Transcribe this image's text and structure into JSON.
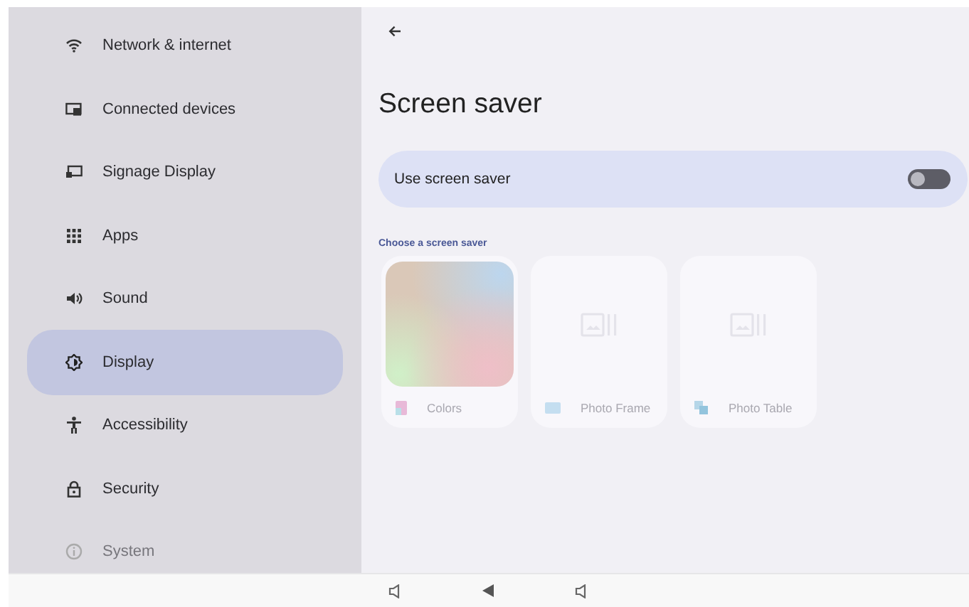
{
  "sidebar": {
    "items": [
      {
        "label": "Network & internet",
        "selected": false
      },
      {
        "label": "Connected devices",
        "selected": false
      },
      {
        "label": "Signage Display",
        "selected": false
      },
      {
        "label": "Apps",
        "selected": false
      },
      {
        "label": "Sound",
        "selected": false
      },
      {
        "label": "Display",
        "selected": true
      },
      {
        "label": "Accessibility",
        "selected": false
      },
      {
        "label": "Security",
        "selected": false
      },
      {
        "label": "System",
        "selected": false
      }
    ]
  },
  "page": {
    "title": "Screen saver",
    "toggle": {
      "label": "Use screen saver",
      "on": false
    },
    "section_label": "Choose a screen saver",
    "cards": [
      {
        "label": "Colors",
        "kind": "gradient"
      },
      {
        "label": "Photo Frame",
        "kind": "placeholder"
      },
      {
        "label": "Photo Table",
        "kind": "placeholder"
      }
    ]
  }
}
